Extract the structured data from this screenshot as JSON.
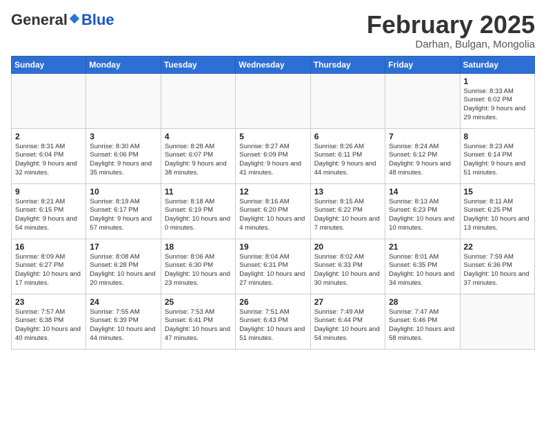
{
  "header": {
    "logo_general": "General",
    "logo_blue": "Blue",
    "month_title": "February 2025",
    "location": "Darhan, Bulgan, Mongolia"
  },
  "days_of_week": [
    "Sunday",
    "Monday",
    "Tuesday",
    "Wednesday",
    "Thursday",
    "Friday",
    "Saturday"
  ],
  "weeks": [
    [
      {
        "day": "",
        "info": ""
      },
      {
        "day": "",
        "info": ""
      },
      {
        "day": "",
        "info": ""
      },
      {
        "day": "",
        "info": ""
      },
      {
        "day": "",
        "info": ""
      },
      {
        "day": "",
        "info": ""
      },
      {
        "day": "1",
        "info": "Sunrise: 8:33 AM\nSunset: 6:02 PM\nDaylight: 9 hours and 29 minutes."
      }
    ],
    [
      {
        "day": "2",
        "info": "Sunrise: 8:31 AM\nSunset: 6:04 PM\nDaylight: 9 hours and 32 minutes."
      },
      {
        "day": "3",
        "info": "Sunrise: 8:30 AM\nSunset: 6:06 PM\nDaylight: 9 hours and 35 minutes."
      },
      {
        "day": "4",
        "info": "Sunrise: 8:28 AM\nSunset: 6:07 PM\nDaylight: 9 hours and 38 minutes."
      },
      {
        "day": "5",
        "info": "Sunrise: 8:27 AM\nSunset: 6:09 PM\nDaylight: 9 hours and 41 minutes."
      },
      {
        "day": "6",
        "info": "Sunrise: 8:26 AM\nSunset: 6:11 PM\nDaylight: 9 hours and 44 minutes."
      },
      {
        "day": "7",
        "info": "Sunrise: 8:24 AM\nSunset: 6:12 PM\nDaylight: 9 hours and 48 minutes."
      },
      {
        "day": "8",
        "info": "Sunrise: 8:23 AM\nSunset: 6:14 PM\nDaylight: 9 hours and 51 minutes."
      }
    ],
    [
      {
        "day": "9",
        "info": "Sunrise: 8:21 AM\nSunset: 6:15 PM\nDaylight: 9 hours and 54 minutes."
      },
      {
        "day": "10",
        "info": "Sunrise: 8:19 AM\nSunset: 6:17 PM\nDaylight: 9 hours and 57 minutes."
      },
      {
        "day": "11",
        "info": "Sunrise: 8:18 AM\nSunset: 6:19 PM\nDaylight: 10 hours and 0 minutes."
      },
      {
        "day": "12",
        "info": "Sunrise: 8:16 AM\nSunset: 6:20 PM\nDaylight: 10 hours and 4 minutes."
      },
      {
        "day": "13",
        "info": "Sunrise: 8:15 AM\nSunset: 6:22 PM\nDaylight: 10 hours and 7 minutes."
      },
      {
        "day": "14",
        "info": "Sunrise: 8:13 AM\nSunset: 6:23 PM\nDaylight: 10 hours and 10 minutes."
      },
      {
        "day": "15",
        "info": "Sunrise: 8:11 AM\nSunset: 6:25 PM\nDaylight: 10 hours and 13 minutes."
      }
    ],
    [
      {
        "day": "16",
        "info": "Sunrise: 8:09 AM\nSunset: 6:27 PM\nDaylight: 10 hours and 17 minutes."
      },
      {
        "day": "17",
        "info": "Sunrise: 8:08 AM\nSunset: 6:28 PM\nDaylight: 10 hours and 20 minutes."
      },
      {
        "day": "18",
        "info": "Sunrise: 8:06 AM\nSunset: 6:30 PM\nDaylight: 10 hours and 23 minutes."
      },
      {
        "day": "19",
        "info": "Sunrise: 8:04 AM\nSunset: 6:31 PM\nDaylight: 10 hours and 27 minutes."
      },
      {
        "day": "20",
        "info": "Sunrise: 8:02 AM\nSunset: 6:33 PM\nDaylight: 10 hours and 30 minutes."
      },
      {
        "day": "21",
        "info": "Sunrise: 8:01 AM\nSunset: 6:35 PM\nDaylight: 10 hours and 34 minutes."
      },
      {
        "day": "22",
        "info": "Sunrise: 7:59 AM\nSunset: 6:36 PM\nDaylight: 10 hours and 37 minutes."
      }
    ],
    [
      {
        "day": "23",
        "info": "Sunrise: 7:57 AM\nSunset: 6:38 PM\nDaylight: 10 hours and 40 minutes."
      },
      {
        "day": "24",
        "info": "Sunrise: 7:55 AM\nSunset: 6:39 PM\nDaylight: 10 hours and 44 minutes."
      },
      {
        "day": "25",
        "info": "Sunrise: 7:53 AM\nSunset: 6:41 PM\nDaylight: 10 hours and 47 minutes."
      },
      {
        "day": "26",
        "info": "Sunrise: 7:51 AM\nSunset: 6:43 PM\nDaylight: 10 hours and 51 minutes."
      },
      {
        "day": "27",
        "info": "Sunrise: 7:49 AM\nSunset: 6:44 PM\nDaylight: 10 hours and 54 minutes."
      },
      {
        "day": "28",
        "info": "Sunrise: 7:47 AM\nSunset: 6:46 PM\nDaylight: 10 hours and 58 minutes."
      },
      {
        "day": "",
        "info": ""
      }
    ]
  ]
}
